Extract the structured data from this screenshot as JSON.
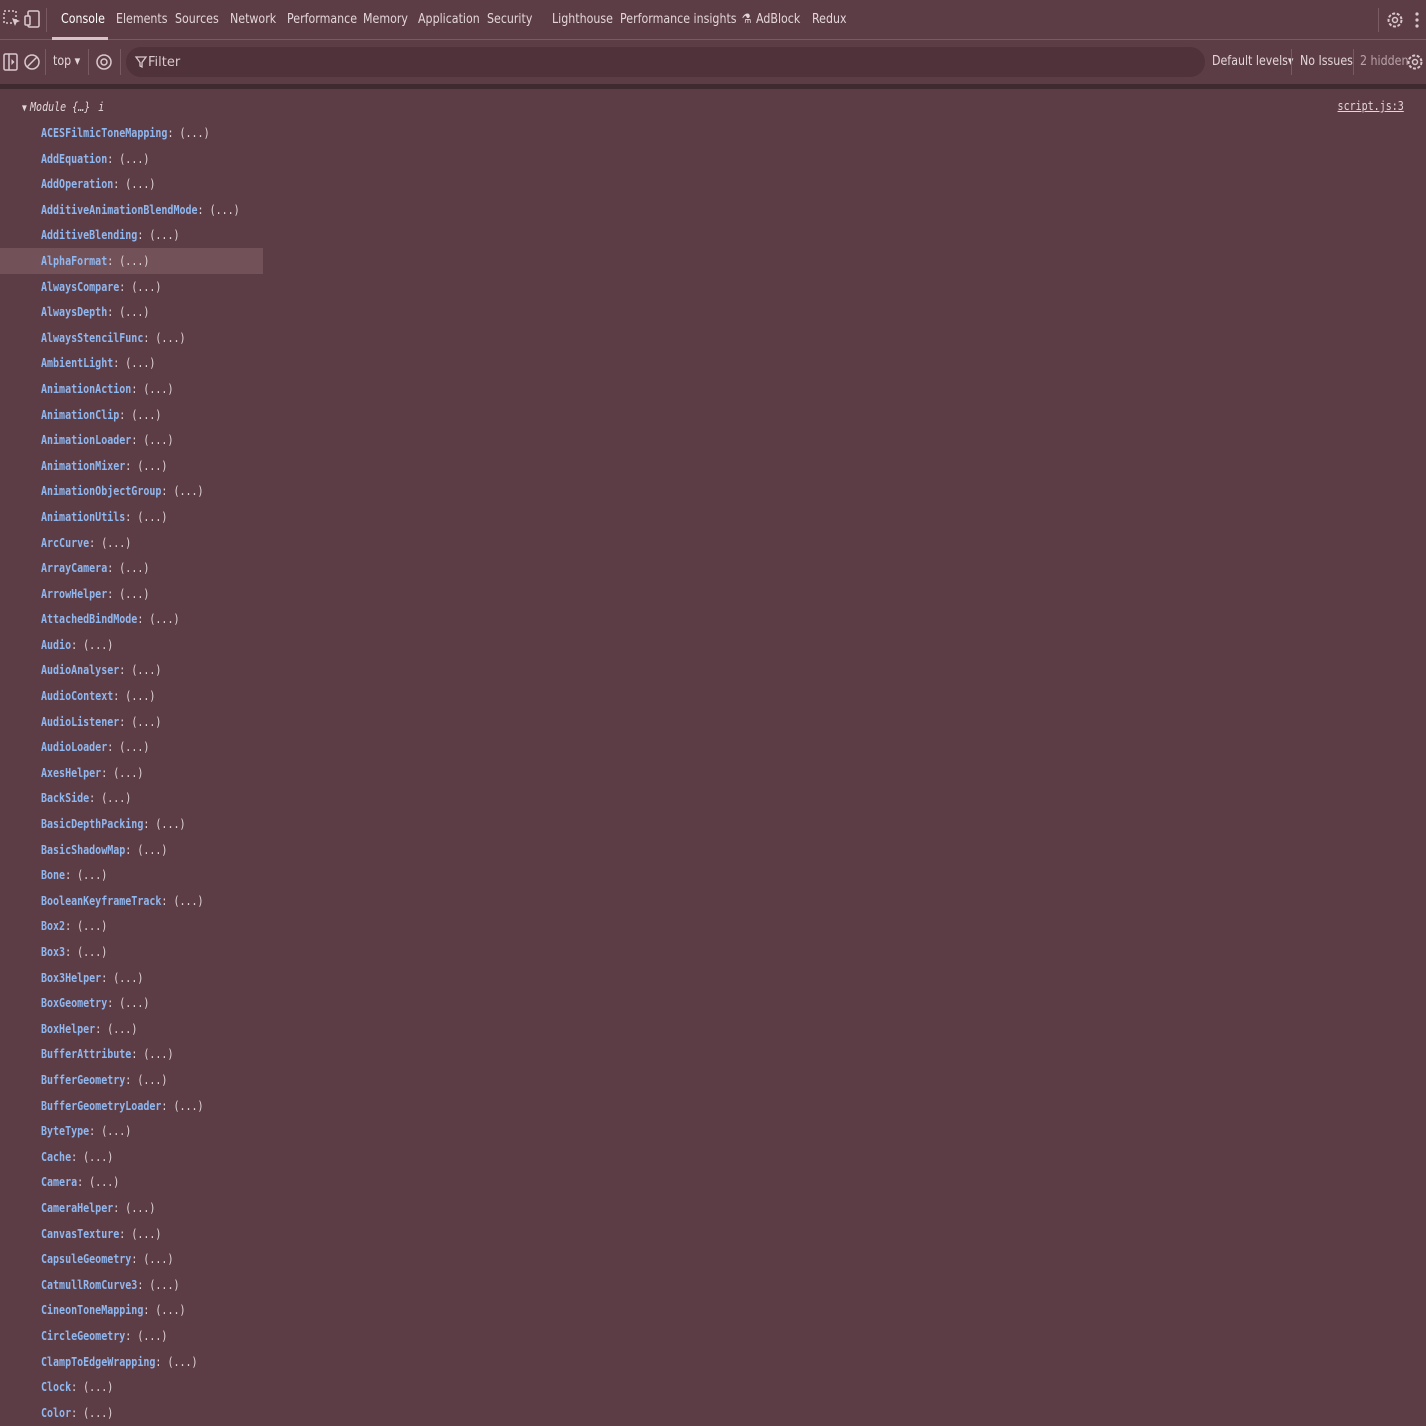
{
  "tabs": [
    "Console",
    "Elements",
    "Sources",
    "Network",
    "Performance",
    "Memory",
    "Application",
    "Security",
    "Lighthouse",
    "Performance insights",
    "AdBlock",
    "Redux"
  ],
  "toolbar": {
    "context": "top",
    "filter_placeholder": "Filter",
    "levels": "Default levels",
    "issues": "No Issues",
    "hidden": "2 hidden"
  },
  "console": {
    "object_label": "Module {…}",
    "info_marker": "i",
    "source": "script.js:3",
    "value_placeholder": "(...)",
    "properties": [
      "ACESFilmicToneMapping",
      "AddEquation",
      "AddOperation",
      "AdditiveAnimationBlendMode",
      "AdditiveBlending",
      "AlphaFormat",
      "AlwaysCompare",
      "AlwaysDepth",
      "AlwaysStencilFunc",
      "AmbientLight",
      "AnimationAction",
      "AnimationClip",
      "AnimationLoader",
      "AnimationMixer",
      "AnimationObjectGroup",
      "AnimationUtils",
      "ArcCurve",
      "ArrayCamera",
      "ArrowHelper",
      "AttachedBindMode",
      "Audio",
      "AudioAnalyser",
      "AudioContext",
      "AudioListener",
      "AudioLoader",
      "AxesHelper",
      "BackSide",
      "BasicDepthPacking",
      "BasicShadowMap",
      "Bone",
      "BooleanKeyframeTrack",
      "Box2",
      "Box3",
      "Box3Helper",
      "BoxGeometry",
      "BoxHelper",
      "BufferAttribute",
      "BufferGeometry",
      "BufferGeometryLoader",
      "ByteType",
      "Cache",
      "Camera",
      "CameraHelper",
      "CanvasTexture",
      "CapsuleGeometry",
      "CatmullRomCurve3",
      "CineonToneMapping",
      "CircleGeometry",
      "ClampToEdgeWrapping",
      "Clock",
      "Color"
    ],
    "highlighted_property": "AlphaFormat"
  },
  "colors": {
    "background": "#5c3d45",
    "property_key": "#8fb7f0",
    "highlight_row": "#735158"
  }
}
